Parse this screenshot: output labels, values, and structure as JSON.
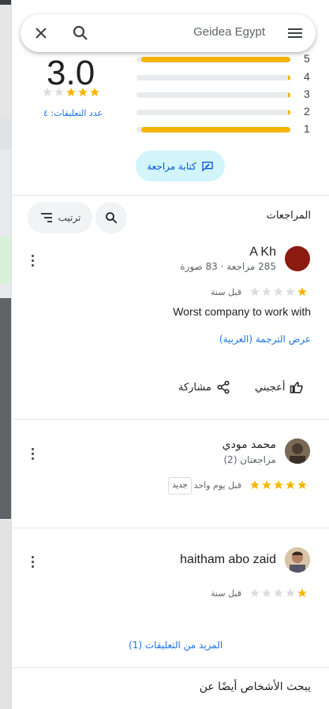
{
  "colors": {
    "star": "#f6b400",
    "link": "#1a73e8",
    "button_bg": "#d2f4fb"
  },
  "search": {
    "place_name": "Geidea Egypt",
    "icons": [
      "close-icon",
      "search-icon",
      "menu-icon"
    ]
  },
  "summary": {
    "rating": "3.0",
    "stars_filled": 3,
    "reviews_label": "عدد التعليقات: ٤",
    "distribution": [
      {
        "label": "5",
        "fraction": 0.97
      },
      {
        "label": "4",
        "fraction": 0.01
      },
      {
        "label": "3",
        "fraction": 0.01
      },
      {
        "label": "2",
        "fraction": 0.01
      },
      {
        "label": "1",
        "fraction": 0.97
      }
    ],
    "write_review_label": "كتابة مراجعة"
  },
  "reviews_section": {
    "title": "المراجعات",
    "sort_label": "ترتيب"
  },
  "reviews": [
    {
      "name": "A Kh",
      "meta": "285 مراجعة · 83 صورة",
      "stars": 1,
      "date": "قبل سنة",
      "text": "Worst company to work with",
      "translate_label": "عرض الترجمة (العربية)",
      "like_label": "أعجبني",
      "share_label": "مشاركة"
    },
    {
      "name": "محمد مودي",
      "meta": "مراجعتان (2)",
      "stars": 5,
      "date": "قبل يوم واحد",
      "badge": "جديد"
    },
    {
      "name": "haitham abo zaid",
      "stars": 1,
      "date": "قبل سنة"
    }
  ],
  "more_reviews_label": "المزيد من التعليقات (1)",
  "people_also_search": "يبحث الأشخاص أيضًا عن"
}
